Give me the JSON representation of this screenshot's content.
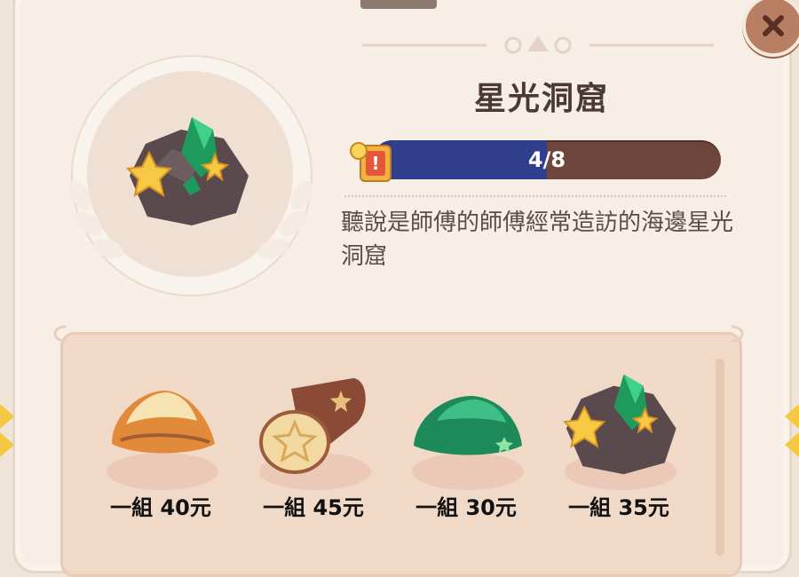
{
  "location": {
    "title": "星光洞窟",
    "progress_text": "4/8",
    "progress_value": 0.5,
    "description": "聽說是師傅的師傅經常造訪的海邊星光洞窟"
  },
  "shop": {
    "items": [
      {
        "name": "sand-pile",
        "price": "一組 40元"
      },
      {
        "name": "star-log",
        "price": "一組 45元"
      },
      {
        "name": "green-moss",
        "price": "一組 30元"
      },
      {
        "name": "star-crystal-ore",
        "price": "一組 35元"
      }
    ]
  },
  "icons": {
    "close": "close-icon",
    "quest": "quest-card-icon"
  },
  "colors": {
    "progress_fill": "#2f3f8d",
    "progress_track": "#6e453b",
    "panel": "#f7eee6",
    "close_button": "#b97f62"
  }
}
